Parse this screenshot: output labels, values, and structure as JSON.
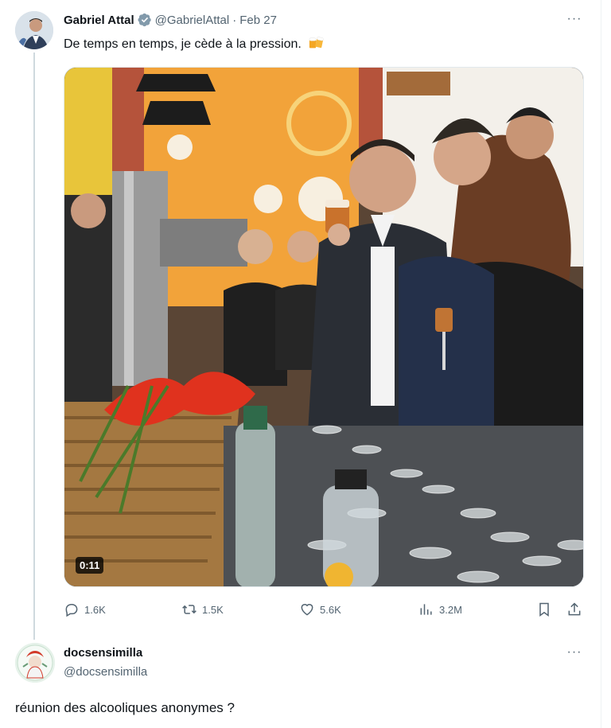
{
  "tweet1": {
    "display_name": "Gabriel Attal",
    "handle": "@GabrielAttal",
    "separator": "·",
    "timestamp": "Feb 27",
    "text": "De temps en temps, je cède à la pression.",
    "emoji": "beer-mugs-icon",
    "more_label": "···",
    "media": {
      "type": "video",
      "duration": "0:11"
    },
    "actions": {
      "replies": "1.6K",
      "reposts": "1.5K",
      "likes": "5.6K",
      "views": "3.2M"
    },
    "verified_color": "#829aab"
  },
  "tweet2": {
    "display_name": "docsensimilla",
    "handle": "@docsensimilla",
    "more_label": "···",
    "text": "réunion des alcooliques anonymes ?"
  },
  "colors": {
    "text_primary": "#0f1419",
    "text_secondary": "#536471",
    "thread_line": "#cfd9de"
  }
}
